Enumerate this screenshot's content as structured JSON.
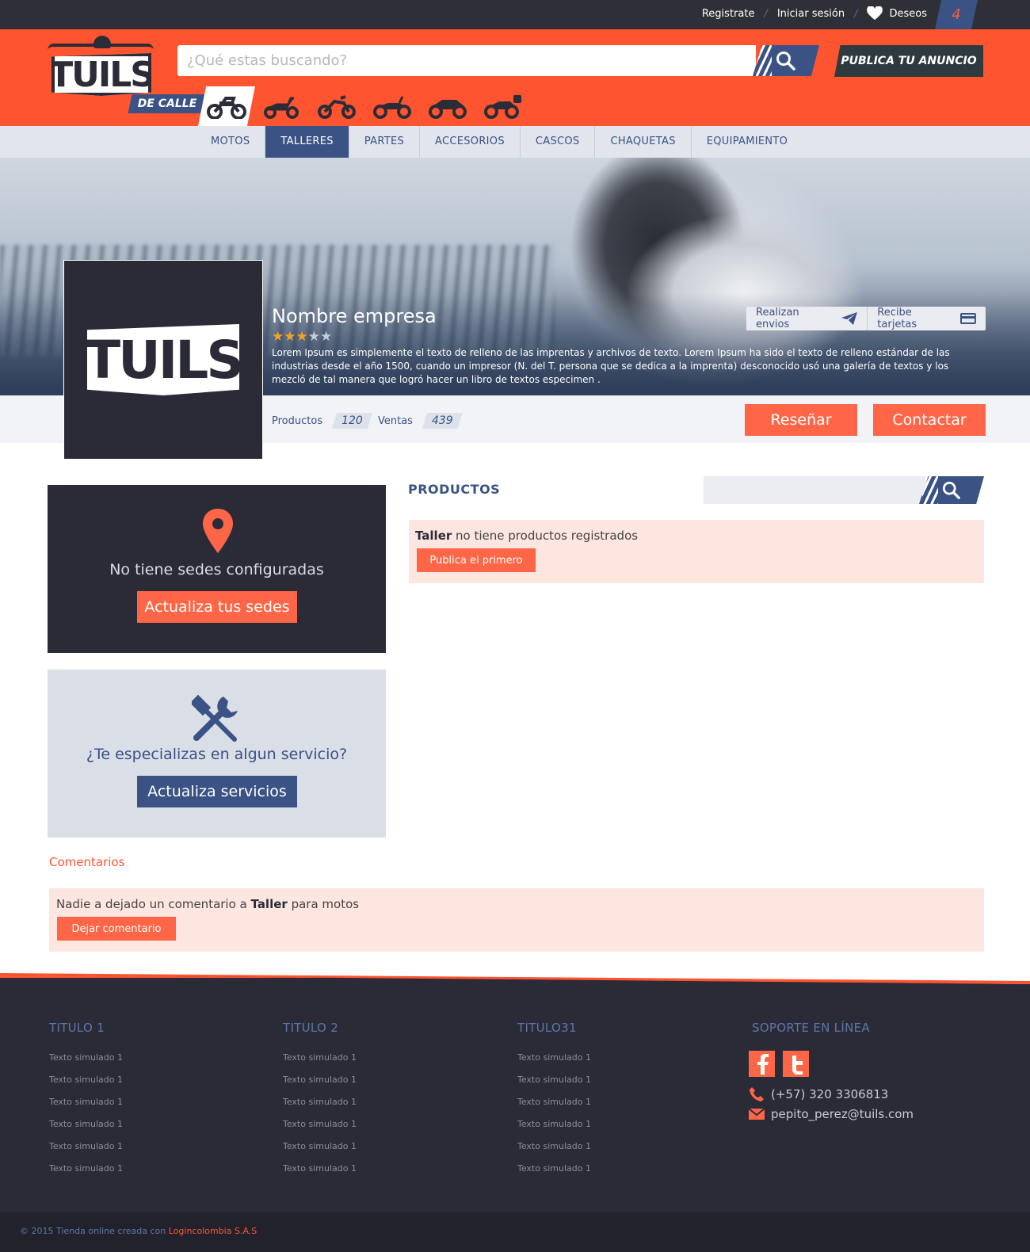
{
  "topbar": {
    "register": "Registrate",
    "login": "Iniciar sesión",
    "wishlist": "Deseos",
    "wishlist_count": "4"
  },
  "header": {
    "logo_text": "TUILS",
    "search_placeholder": "¿Qué estas buscando?",
    "publish_label": "PUBLICA TU ANUNCIO",
    "category_label": "DE CALLE",
    "category_icons": [
      "dirt-bike-icon",
      "scooter-icon",
      "motocross-icon",
      "cruiser-icon",
      "sport-bike-icon",
      "touring-bike-icon"
    ]
  },
  "nav": {
    "items": [
      "MOTOS",
      "TALLERES",
      "PARTES",
      "ACCESORIOS",
      "CASCOS",
      "CHAQUETAS",
      "EQUIPAMIENTO"
    ],
    "active": "TALLERES"
  },
  "company": {
    "logo_text": "TUILS",
    "name": "Nombre empresa",
    "rating": 3,
    "rating_max": 5,
    "description": "Lorem Ipsum es simplemente el texto de relleno de las imprentas y archivos de texto. Lorem Ipsum ha sido el texto de relleno estándar de las industrias desde el año 1500, cuando un impresor (N. del T. persona que se dedica a la imprenta) desconocido usó una galería de textos y los mezcló de tal manera que logró hacer un libro de textos especimen  .",
    "badge_shipping": "Realizan envios",
    "badge_cards": "Recibe tarjetas",
    "products_label": "Productos",
    "products_count": "120",
    "sales_label": "Ventas",
    "sales_count": "439",
    "review_btn": "Reseñar",
    "contact_btn": "Contactar"
  },
  "sidebar": {
    "locations_title": "No tiene sedes configuradas",
    "locations_btn": "Actualiza tus sedes",
    "services_title": "¿Te especializas en algun servicio?",
    "services_btn": "Actualiza servicios"
  },
  "products": {
    "title": "PRODUCTOS",
    "empty_bold": "Taller",
    "empty_text": " no tiene productos registrados",
    "first_btn": "Publica el primero"
  },
  "comments": {
    "title": "Comentarios",
    "empty_prefix": "Nadie a dejado un comentario a ",
    "empty_bold": "Taller",
    "empty_suffix": " para motos",
    "btn": "Dejar comentario"
  },
  "footer": {
    "columns": [
      {
        "title": "TITULO 1",
        "links": [
          "Texto simulado 1",
          "Texto simulado 1",
          "Texto simulado 1",
          "Texto simulado 1",
          "Texto simulado 1",
          "Texto simulado 1"
        ]
      },
      {
        "title": "TITULO 2",
        "links": [
          "Texto simulado 1",
          "Texto simulado 1",
          "Texto simulado 1",
          "Texto simulado 1",
          "Texto simulado 1",
          "Texto simulado 1"
        ]
      },
      {
        "title": "TITULO31",
        "links": [
          "Texto simulado 1",
          "Texto simulado 1",
          "Texto simulado 1",
          "Texto simulado 1",
          "Texto simulado 1",
          "Texto simulado 1"
        ]
      }
    ],
    "support_title": "SOPORTE EN LÍNEA",
    "phone": "(+57) 320 3306813",
    "email": "pepito_perez@tuils.com",
    "copyright_prefix": "© 2015 Tienda online creada con ",
    "copyright_link": "Logincolombia S.A.S"
  },
  "colors": {
    "brand_orange": "#ff5430",
    "brand_blue": "#3a5284",
    "dark": "#2b2a37",
    "star": "#f7a21b"
  }
}
